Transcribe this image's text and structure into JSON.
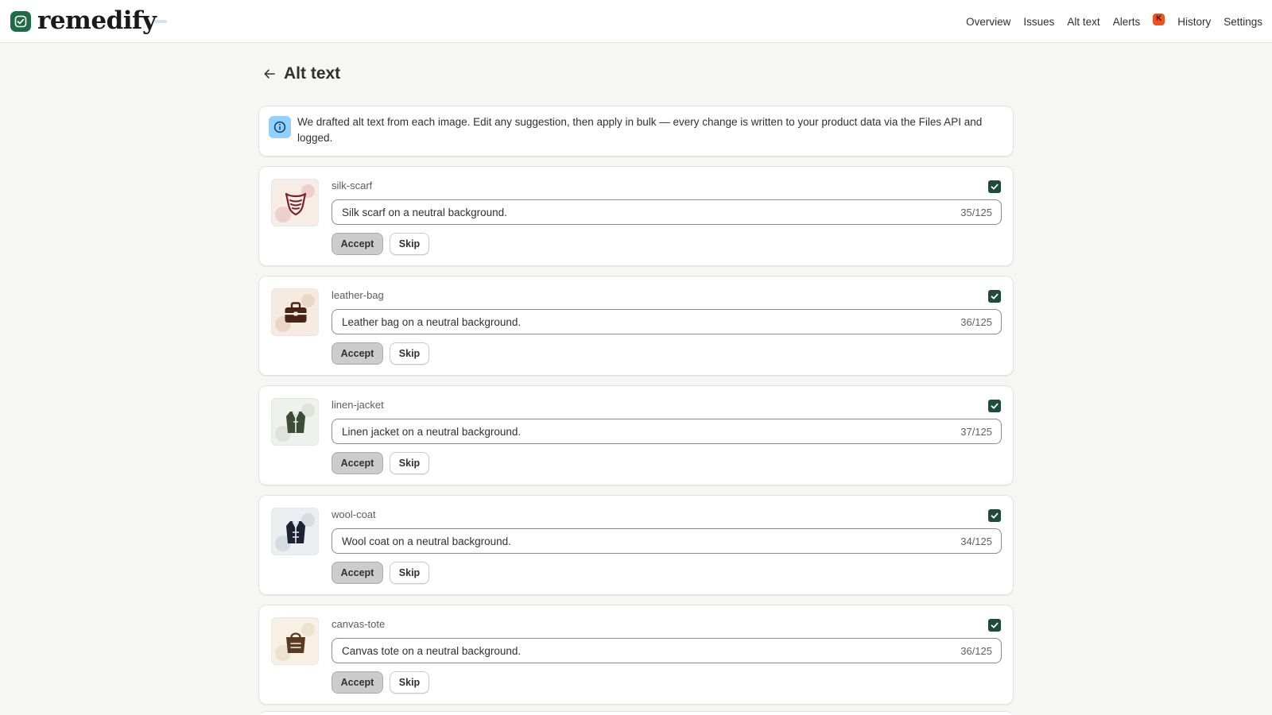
{
  "app": {
    "name": "remedify"
  },
  "nav": {
    "items": [
      {
        "label": "Overview"
      },
      {
        "label": "Issues"
      },
      {
        "label": "Alt text"
      },
      {
        "label": "Alerts"
      },
      {
        "label": "History"
      },
      {
        "label": "Settings"
      }
    ],
    "badge_letter": "K"
  },
  "page": {
    "title": "Alt text"
  },
  "info": {
    "text": "We drafted alt text from each image. Edit any suggestion, then apply in bulk — every change is written to your product data via the Files API and logged."
  },
  "items": [
    {
      "handle": "silk-scarf",
      "alt": "Silk scarf on a neutral background.",
      "count": "35/125",
      "accept": "Accept",
      "skip": "Skip",
      "selected": true,
      "icon": "scarf-icon",
      "thumb_bg": "#f7ece6",
      "blob": "#e6b8b8",
      "ink": "#7a1f2b"
    },
    {
      "handle": "leather-bag",
      "alt": "Leather bag on a neutral background.",
      "count": "36/125",
      "accept": "Accept",
      "skip": "Skip",
      "selected": true,
      "icon": "bag-icon",
      "thumb_bg": "#f6ebe0",
      "blob": "#e2c7b0",
      "ink": "#4a2316"
    },
    {
      "handle": "linen-jacket",
      "alt": "Linen jacket on a neutral background.",
      "count": "37/125",
      "accept": "Accept",
      "skip": "Skip",
      "selected": true,
      "icon": "jacket-icon",
      "thumb_bg": "#eef1ec",
      "blob": "#cfd9cd",
      "ink": "#3b4d35"
    },
    {
      "handle": "wool-coat",
      "alt": "Wool coat on a neutral background.",
      "count": "34/125",
      "accept": "Accept",
      "skip": "Skip",
      "selected": true,
      "icon": "coat-icon",
      "thumb_bg": "#eceef2",
      "blob": "#c7ccd6",
      "ink": "#1c2233"
    },
    {
      "handle": "canvas-tote",
      "alt": "Canvas tote on a neutral background.",
      "count": "36/125",
      "accept": "Accept",
      "skip": "Skip",
      "selected": true,
      "icon": "tote-icon",
      "thumb_bg": "#f7f0e3",
      "blob": "#e6d7bc",
      "ink": "#5a3a22"
    }
  ],
  "colors": {
    "brand": "#1f6b45",
    "checkbox": "#1d4d3a",
    "info_icon_bg": "#91d0ff",
    "badge": "#f0521e"
  }
}
